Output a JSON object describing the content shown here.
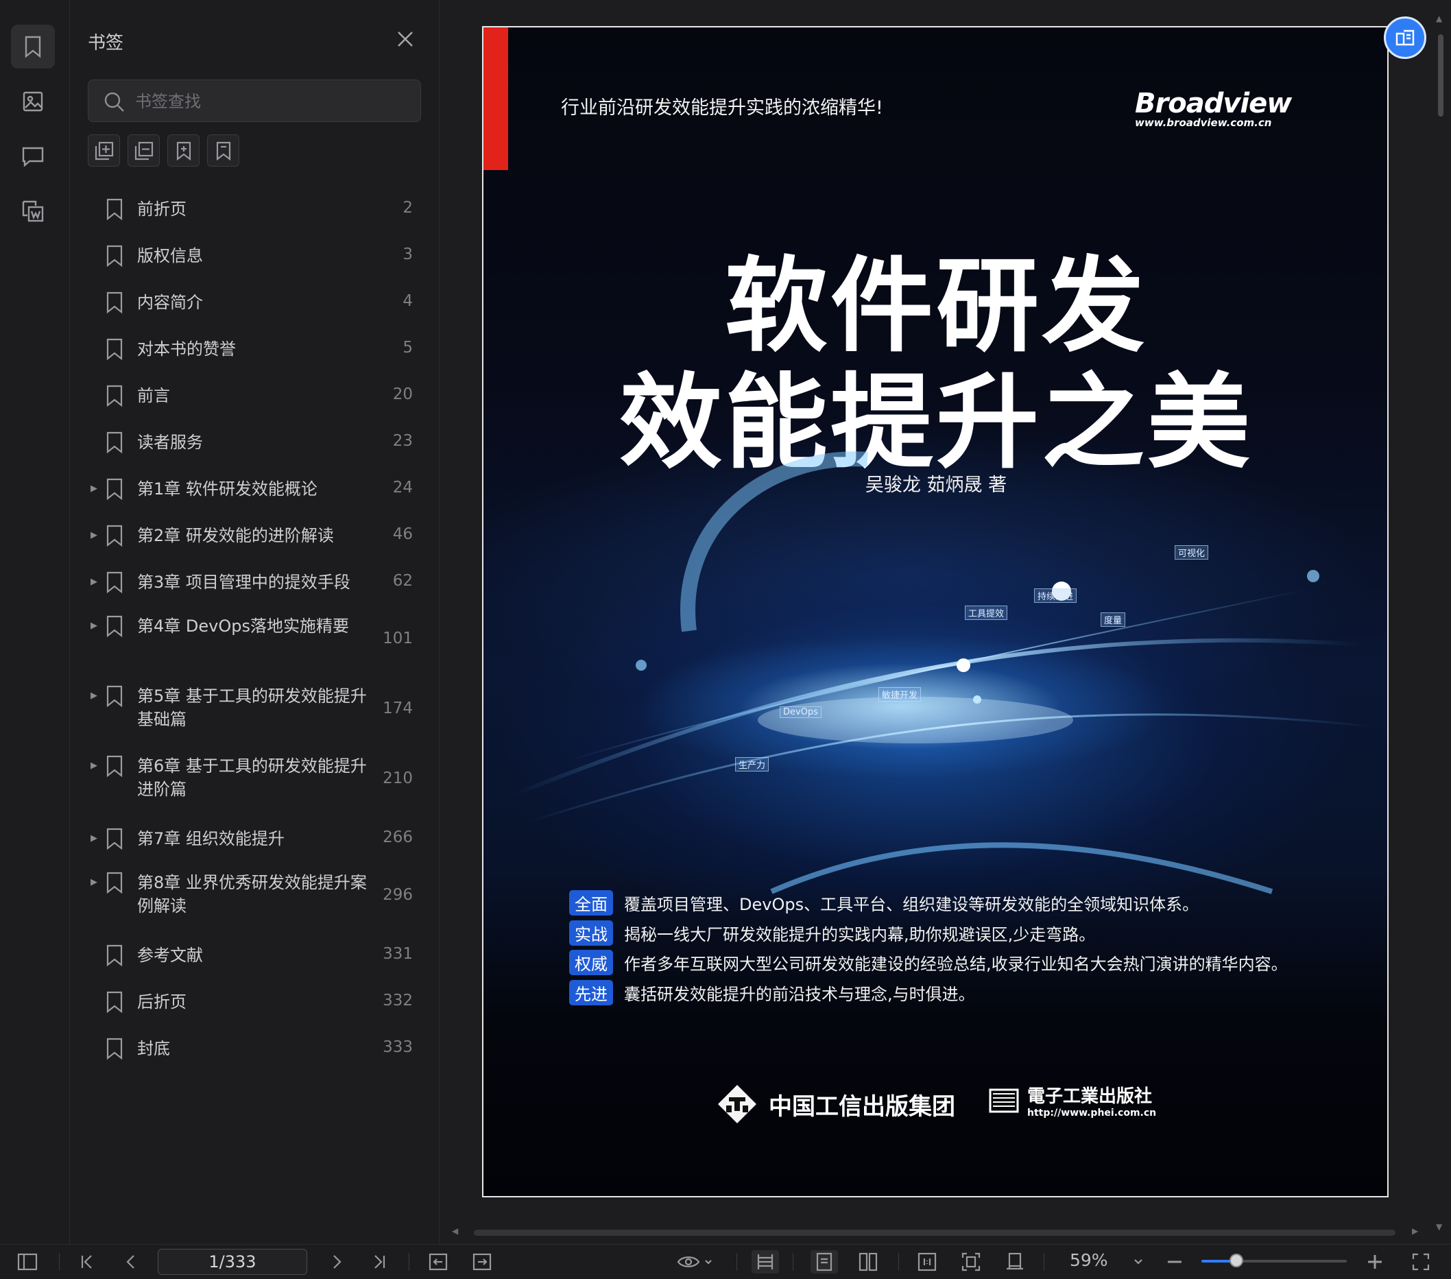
{
  "sidebar_rail": {
    "items": [
      {
        "name": "bookmark-icon"
      },
      {
        "name": "thumbnail-icon"
      },
      {
        "name": "comment-icon"
      },
      {
        "name": "convert-doc-icon"
      }
    ]
  },
  "bookmark_panel": {
    "title": "书签",
    "search_placeholder": "书签查找",
    "items": [
      {
        "label": "前折页",
        "page": "2",
        "expandable": false
      },
      {
        "label": "版权信息",
        "page": "3",
        "expandable": false
      },
      {
        "label": "内容简介",
        "page": "4",
        "expandable": false
      },
      {
        "label": "对本书的赞誉",
        "page": "5",
        "expandable": false
      },
      {
        "label": "前言",
        "page": "20",
        "expandable": false
      },
      {
        "label": "读者服务",
        "page": "23",
        "expandable": false
      },
      {
        "label": "第1章 软件研发效能概论",
        "page": "24",
        "expandable": true
      },
      {
        "label": "第2章 研发效能的进阶解读",
        "page": "46",
        "expandable": true
      },
      {
        "label": "第3章 项目管理中的提效手段",
        "page": "62",
        "expandable": true
      },
      {
        "label": "第4章 DevOps落地实施精要",
        "page": "101",
        "expandable": true
      },
      {
        "label": "第5章 基于工具的研发效能提升基础篇",
        "page": "174",
        "expandable": true
      },
      {
        "label": "第6章 基于工具的研发效能提升进阶篇",
        "page": "210",
        "expandable": true
      },
      {
        "label": "第7章 组织效能提升",
        "page": "266",
        "expandable": true
      },
      {
        "label": "第8章 业界优秀研发效能提升案例解读",
        "page": "296",
        "expandable": true
      },
      {
        "label": "参考文献",
        "page": "331",
        "expandable": false
      },
      {
        "label": "后折页",
        "page": "332",
        "expandable": false
      },
      {
        "label": "封底",
        "page": "333",
        "expandable": false
      }
    ]
  },
  "cover": {
    "tagline": "行业前沿研发效能提升实践的浓缩精华!",
    "brand": "Broadview",
    "brand_url": "www.broadview.com.cn",
    "title_line1": "软件研发",
    "title_line2": "效能提升之美",
    "authors": "吴骏龙    茹炳晟    著",
    "nodes": [
      "可视化",
      "持续改进",
      "工具提效",
      "度量",
      "敏捷开发",
      "DevOps",
      "生产力"
    ],
    "features": [
      {
        "tag": "全面",
        "text": "覆盖项目管理、DevOps、工具平台、组织建设等研发效能的全领域知识体系。"
      },
      {
        "tag": "实战",
        "text": "揭秘一线大厂研发效能提升的实践内幕,助你规避误区,少走弯路。"
      },
      {
        "tag": "权威",
        "text": "作者多年互联网大型公司研发效能建设的经验总结,收录行业知名大会热门演讲的精华内容。"
      },
      {
        "tag": "先进",
        "text": "囊括研发效能提升的前沿技术与理念,与时俱进。"
      }
    ],
    "publisher1": "中国工信出版集团",
    "publisher2": "電子工業出版社",
    "publisher2_url": "http://www.phei.com.cn",
    "colors": {
      "red_bar": "#e2231a",
      "tag_blue": "#1f5bd6"
    }
  },
  "toolbar": {
    "page_indicator": "1/333",
    "zoom": "59%",
    "zoom_level": 0.59,
    "accent": "#2f7df6"
  }
}
